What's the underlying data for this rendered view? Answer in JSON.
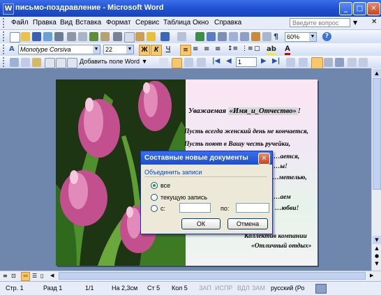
{
  "window": {
    "title": "письмо-поздравление - Microsoft Word"
  },
  "menu": {
    "items": [
      "Файл",
      "Правка",
      "Вид",
      "Вставка",
      "Формат",
      "Сервис",
      "Таблица",
      "Окно",
      "Справка"
    ],
    "help_placeholder": "Введите вопрос"
  },
  "standard_toolbar": {
    "zoom": "60%"
  },
  "formatting_toolbar": {
    "style": "Monotype Corsiva",
    "size": "22",
    "bold": "Ж",
    "italic": "К",
    "underline": "Ч"
  },
  "mail_merge_toolbar": {
    "insert_field": "Добавить поле Word",
    "record": "1"
  },
  "document": {
    "greeting_prefix": "Уважаемая",
    "merge_field": "«Имя_и_Отчество»",
    "greeting_suffix": "!",
    "lines": [
      "Пусть всегда женский день не кончается,",
      "Пусть поют в Вашу честь ручейки,",
      "…ается,",
      "…ы!",
      "…метелью,",
      "…аем",
      "…юбви!"
    ],
    "signature_1": "Коллектив компании",
    "signature_2": "«Отличный отдых»"
  },
  "dialog": {
    "title": "Составные новые документы",
    "group_label": "Объединить записи",
    "option_all": "все",
    "option_current": "текущую запись",
    "option_from": "с:",
    "to_label": "по:",
    "ok_label": "ОК",
    "cancel_label": "Отмена"
  },
  "status": {
    "page": "Стр. 1",
    "section": "Разд 1",
    "pages": "1/1",
    "position": "На 2,3см",
    "line": "Ст 5",
    "column": "Кол 5",
    "modes": [
      "ЗАП",
      "ИСПР",
      "ВДЛ",
      "ЗАМ"
    ],
    "language": "русский (Ро"
  },
  "colors": {
    "titlebar": "#245edb",
    "page_bg": "#6f86ad"
  }
}
